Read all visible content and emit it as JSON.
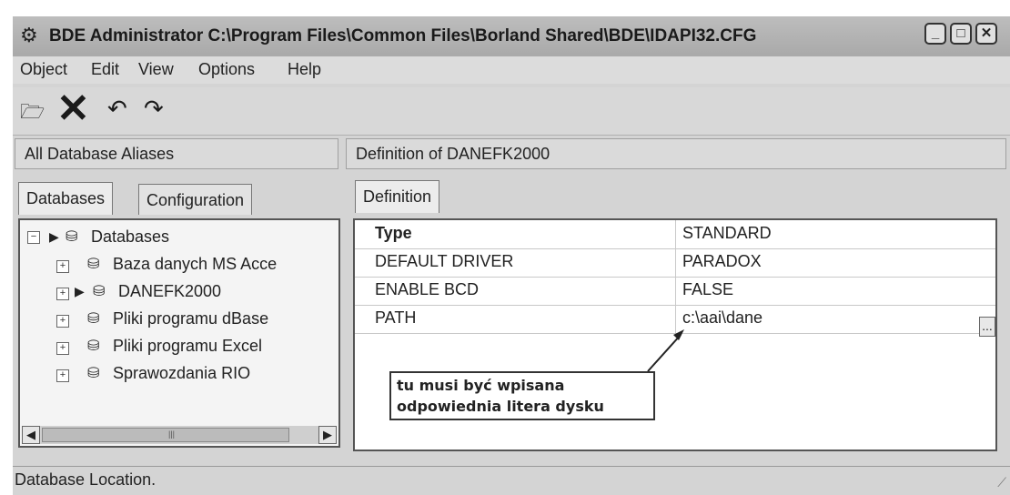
{
  "window": {
    "title": "BDE Administrator  C:\\Program Files\\Common Files\\Borland Shared\\BDE\\IDAPI32.CFG",
    "app_icon": "bde-app-icon"
  },
  "menu": [
    "Object",
    "Edit",
    "View",
    "Options",
    "Help"
  ],
  "toolbar": {
    "icons": [
      "open-folder-icon",
      "delete-icon",
      "undo-icon",
      "redo-icon"
    ]
  },
  "left_panel": {
    "header": "All Database Aliases",
    "tabs": [
      "Databases",
      "Configuration"
    ],
    "active_tab": "Databases",
    "tree": {
      "root": "Databases",
      "items": [
        {
          "label": "Baza danych MS Acce",
          "icon": "database-icon"
        },
        {
          "label": "DANEFK2000",
          "icon": "database-alias-icon",
          "selected": true
        },
        {
          "label": "Pliki programu dBase",
          "icon": "database-icon"
        },
        {
          "label": "Pliki programu Excel",
          "icon": "database-icon"
        },
        {
          "label": "Sprawozdania RIO",
          "icon": "database-alias-icon"
        }
      ]
    }
  },
  "right_panel": {
    "header": "Definition of DANEFK2000",
    "tab": "Definition",
    "rows": [
      {
        "key": "Type",
        "value": "STANDARD"
      },
      {
        "key": "DEFAULT DRIVER",
        "value": "PARADOX"
      },
      {
        "key": "ENABLE BCD",
        "value": "FALSE"
      },
      {
        "key": "PATH",
        "value": "c:\\aai\\dane"
      }
    ],
    "ellipsis": "..."
  },
  "callout": {
    "line1": "tu musi być wpisana",
    "line2": "odpowiednia litera dysku"
  },
  "status": {
    "text": "Database Location."
  }
}
